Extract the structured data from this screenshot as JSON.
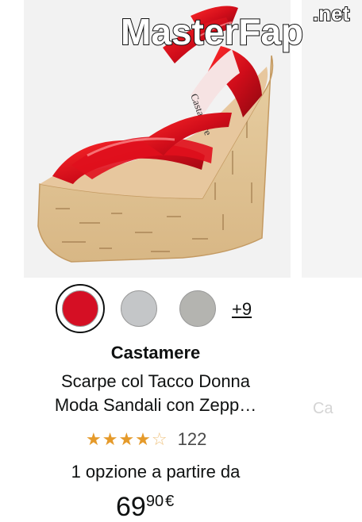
{
  "watermark": {
    "text_main": "MasterFap",
    "text_suffix": ".net"
  },
  "product": {
    "image_alt": "red patent platform wedge sandal with cork heel",
    "sole_brand": "Castamere",
    "variants": {
      "colors": [
        "#d50f24",
        "#c4c6c8",
        "#b4b4b0"
      ],
      "more_label": "+9"
    },
    "brand": "Castamere",
    "title_line1": "Scarpe col Tacco Donna",
    "title_line2": "Moda Sandali con Zepp…",
    "rating": {
      "stars": 4.5,
      "count": "122"
    },
    "options_text": "1 opzione a partire da",
    "price": {
      "whole": "69",
      "fraction": "90",
      "currency": "€"
    }
  },
  "next_card": {
    "partial_text": "Ca"
  }
}
